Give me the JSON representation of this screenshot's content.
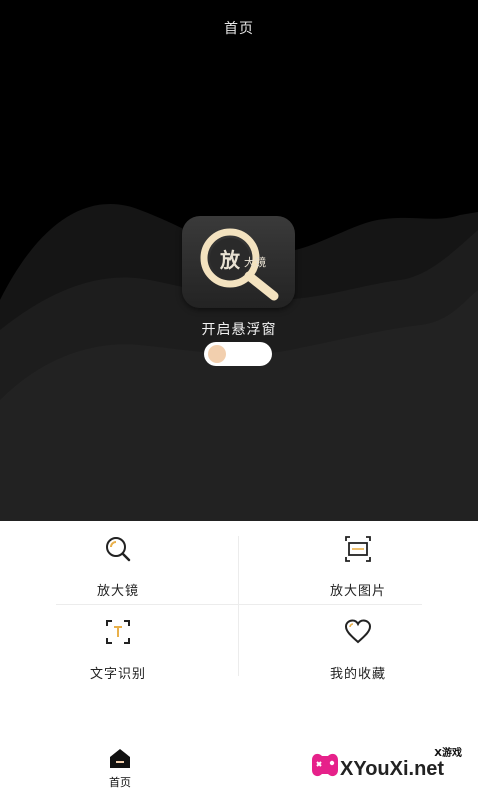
{
  "header": {
    "title": "首页"
  },
  "hero": {
    "app_icon": {
      "main_text": "放",
      "sub_text": "大镜",
      "icon": "magnifier-app-icon"
    },
    "float_label": "开启悬浮窗",
    "float_toggle_on": false
  },
  "features": [
    {
      "label": "放大镜",
      "icon": "magnifier-icon"
    },
    {
      "label": "放大图片",
      "icon": "image-zoom-icon"
    },
    {
      "label": "文字识别",
      "icon": "text-scan-icon"
    },
    {
      "label": "我的收藏",
      "icon": "heart-icon"
    }
  ],
  "bottom_nav": {
    "home_label": "首页",
    "home_icon": "home-icon"
  },
  "watermark": {
    "tag": "X游戏",
    "text": "XYouXi.net"
  },
  "colors": {
    "hero_bg": "#000000",
    "accent": "#f2cfae",
    "ring": "#f3e2bf"
  }
}
